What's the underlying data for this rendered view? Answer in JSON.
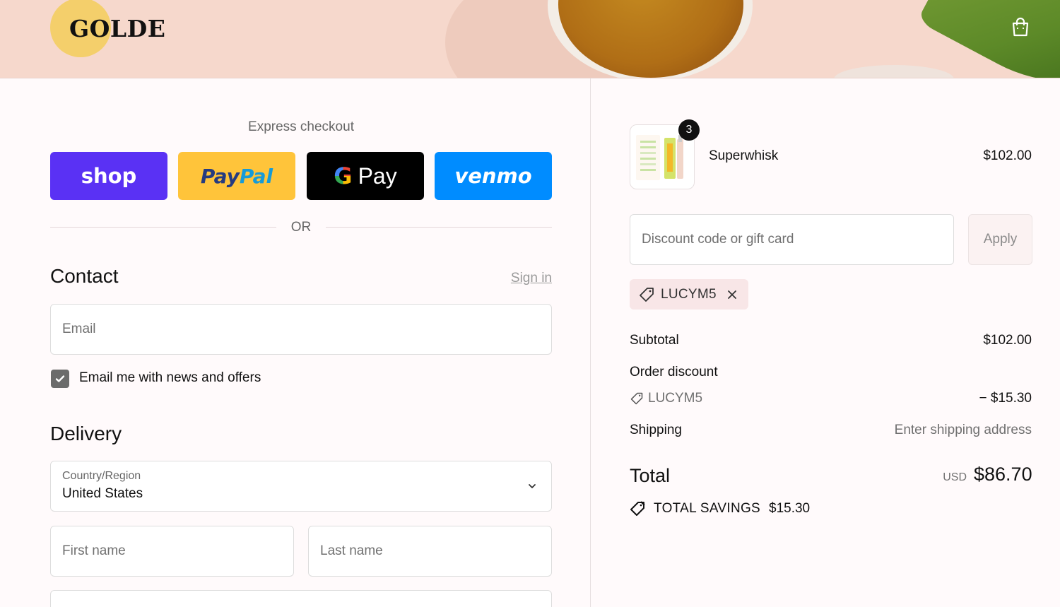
{
  "header": {
    "brand": "GOLDE",
    "cart_icon": "shopping-bag-icon"
  },
  "express": {
    "title": "Express checkout",
    "buttons": {
      "shop": "shop",
      "paypal_1": "Pay",
      "paypal_2": "Pal",
      "gpay_g": "G",
      "gpay_text": "Pay",
      "venmo": "venmo"
    },
    "or": "OR"
  },
  "contact": {
    "title": "Contact",
    "signin": "Sign in",
    "email_placeholder": "Email",
    "newsletter_label": "Email me with news and offers",
    "newsletter_checked": true
  },
  "delivery": {
    "title": "Delivery",
    "country_label": "Country/Region",
    "country_value": "United States",
    "first_name_placeholder": "First name",
    "last_name_placeholder": "Last name"
  },
  "order": {
    "product": {
      "name": "Superwhisk",
      "price": "$102.00",
      "quantity": "3"
    },
    "discount_placeholder": "Discount code or gift card",
    "apply": "Apply",
    "applied_code": "LUCYM5",
    "subtotal_label": "Subtotal",
    "subtotal_value": "$102.00",
    "order_discount_label": "Order discount",
    "discount_code": "LUCYM5",
    "discount_value": "− $15.30",
    "shipping_label": "Shipping",
    "shipping_value": "Enter shipping address",
    "total_label": "Total",
    "total_currency": "USD",
    "total_value": "$86.70",
    "savings_label": "TOTAL SAVINGS",
    "savings_value": "$15.30"
  },
  "colors": {
    "shop": "#5a31f4",
    "paypal": "#ffc43a",
    "gpay": "#000000",
    "venmo": "#008cff",
    "logo": "#f4cf6b",
    "banner": "#f6d8cc"
  }
}
